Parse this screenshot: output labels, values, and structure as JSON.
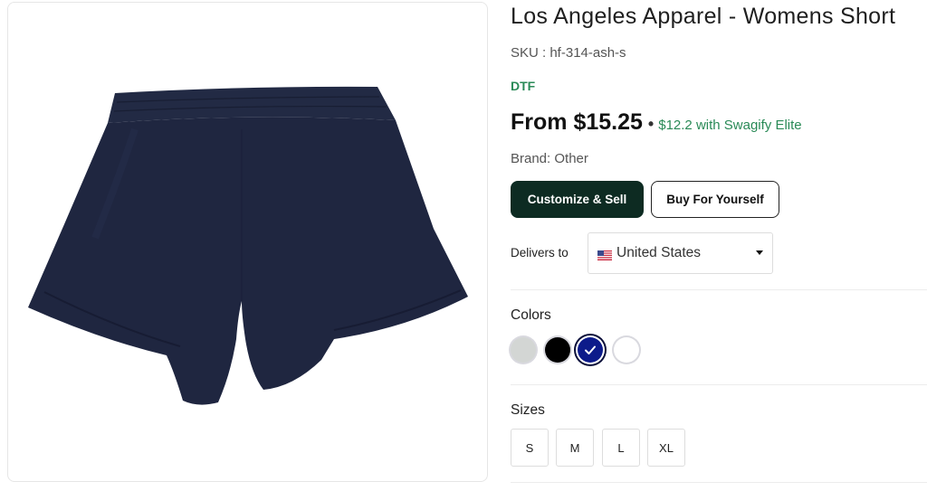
{
  "product": {
    "title": "Los Angeles Apparel - Womens Short",
    "sku": "SKU : hf-314-ash-s",
    "print_method": "DTF",
    "price": "From $15.25",
    "separator": "•",
    "elite_price": "$12.2 with Swagify Elite",
    "brand": "Brand: Other",
    "image_icon": "navy-shorts-image"
  },
  "actions": {
    "customize_label": "Customize & Sell",
    "buy_label": "Buy For Yourself"
  },
  "delivery": {
    "label": "Delivers to",
    "country": "United States",
    "flag_icon": "us-flag-icon"
  },
  "colors": {
    "label": "Colors",
    "swatches": [
      {
        "name": "ash",
        "hex": "#d3d6d4",
        "selected": false
      },
      {
        "name": "black",
        "hex": "#000000",
        "selected": false
      },
      {
        "name": "navy",
        "hex": "#0d1b8a",
        "selected": true
      },
      {
        "name": "white",
        "hex": "#ffffff",
        "selected": false
      }
    ]
  },
  "sizes": {
    "label": "Sizes",
    "options": [
      "S",
      "M",
      "L",
      "XL"
    ]
  },
  "theme": {
    "accent_green": "#2a8a57",
    "primary_button": "#0d2b22",
    "shorts_color": "#1f2640"
  }
}
